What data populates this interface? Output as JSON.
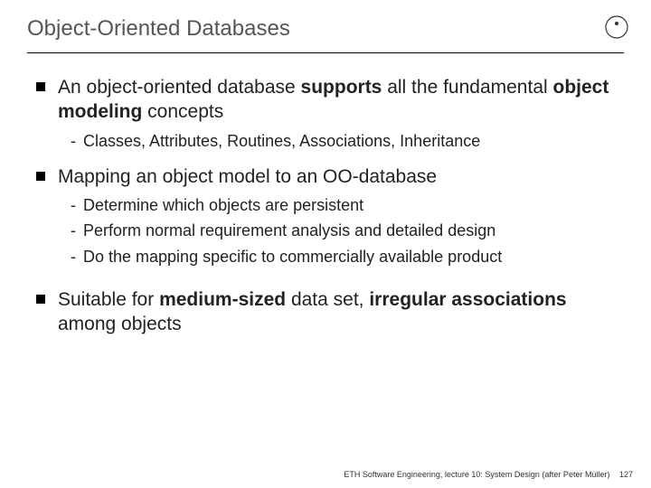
{
  "title": "Object-Oriented Databases",
  "bullets": [
    {
      "parts": [
        {
          "t": "An object-oriented database ",
          "b": false
        },
        {
          "t": "supports",
          "b": true
        },
        {
          "t": " all the fundamental ",
          "b": false
        },
        {
          "t": "object modeling",
          "b": true
        },
        {
          "t": " concepts",
          "b": false
        }
      ],
      "subs": [
        "Classes, Attributes, Routines, Associations, Inheritance"
      ]
    },
    {
      "parts": [
        {
          "t": "Mapping an object model to an OO-database",
          "b": false
        }
      ],
      "subs": [
        "Determine which objects are persistent",
        "Perform normal requirement analysis and detailed design",
        "Do the mapping specific to commercially available product"
      ]
    },
    {
      "parts": [
        {
          "t": "Suitable for ",
          "b": false
        },
        {
          "t": "medium-sized",
          "b": true
        },
        {
          "t": " data set, ",
          "b": false
        },
        {
          "t": "irregular associations",
          "b": true
        },
        {
          "t": " among objects",
          "b": false
        }
      ],
      "subs": []
    }
  ],
  "footer": "ETH Software Engineering, lecture 10: System Design (after Peter Müller)",
  "page": "127"
}
